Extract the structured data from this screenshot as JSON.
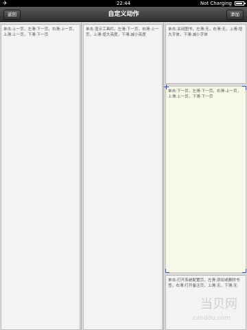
{
  "status_bar": {
    "time": "22:44",
    "charging": "Not Charging",
    "airplane_icon": "airplane-icon",
    "battery_icon": "battery-icon"
  },
  "nav": {
    "title": "自定义动作",
    "back_label": "返回",
    "add_label": "添加"
  },
  "columns": [
    {
      "zones": [
        {
          "text": "单击:上一页，左滑:下一页，右滑:上一页，上滑:上一页，下滑:下一页"
        }
      ]
    },
    {
      "zones": [
        {
          "text": "单击:显示工具栏，左滑:下一页，右滑:上一页，上滑:增大亮度，下滑:减小亮度"
        }
      ]
    },
    {
      "zones": [
        {
          "text": "单击:关闭图书，左滑:无，右滑:无，上滑:增大字体，下滑:减小字体"
        },
        {
          "text": "单击:下一页，左滑:下一页，右滑:上一页，上滑:上一页，下滑:下一页",
          "selected": true
        },
        {
          "text": "单击:打开系统配置页，左滑:添加或删除书签，右滑:打开备注页，上滑:无，下滑:无"
        }
      ]
    }
  ],
  "watermark": {
    "text": "当贝网",
    "sub": "candou.com"
  }
}
